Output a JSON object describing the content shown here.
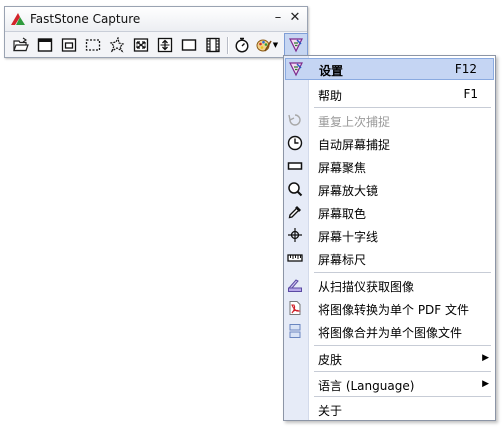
{
  "window": {
    "title": "FastStone Capture",
    "minimize_label": "–",
    "close_label": "✕"
  },
  "toolbar": {
    "tools": [
      {
        "name": "open-file-icon"
      },
      {
        "name": "capture-active-window-icon"
      },
      {
        "name": "capture-window-object-icon"
      },
      {
        "name": "capture-rectangular-region-icon"
      },
      {
        "name": "capture-freehand-region-icon"
      },
      {
        "name": "capture-full-screen-icon"
      },
      {
        "name": "capture-scrolling-window-icon"
      },
      {
        "name": "capture-fixed-region-icon"
      },
      {
        "name": "screen-recorder-icon"
      },
      {
        "name": "delay-timer-icon"
      },
      {
        "name": "output-destination-icon"
      },
      {
        "name": "settings-menu-icon"
      }
    ]
  },
  "menu": {
    "items": [
      {
        "label": "设置",
        "shortcut": "F12",
        "icon": "settings-icon",
        "state": "highlighted"
      },
      {
        "label": "帮助",
        "shortcut": "F1",
        "icon": "",
        "state": "normal"
      },
      {
        "label": "重复上次捕捉",
        "shortcut": "",
        "icon": "repeat-capture-icon",
        "state": "disabled"
      },
      {
        "label": "自动屏幕捕捉",
        "shortcut": "",
        "icon": "clock-icon",
        "state": "normal"
      },
      {
        "label": "屏幕聚焦",
        "shortcut": "",
        "icon": "focus-bar-icon",
        "state": "normal"
      },
      {
        "label": "屏幕放大镜",
        "shortcut": "",
        "icon": "magnifier-icon",
        "state": "normal"
      },
      {
        "label": "屏幕取色",
        "shortcut": "",
        "icon": "color-picker-icon",
        "state": "normal"
      },
      {
        "label": "屏幕十字线",
        "shortcut": "",
        "icon": "crosshair-icon",
        "state": "normal"
      },
      {
        "label": "屏幕标尺",
        "shortcut": "",
        "icon": "ruler-icon",
        "state": "normal"
      },
      {
        "label": "从扫描仪获取图像",
        "shortcut": "",
        "icon": "scanner-icon",
        "state": "normal"
      },
      {
        "label": "将图像转换为单个 PDF 文件",
        "shortcut": "",
        "icon": "pdf-icon",
        "state": "normal"
      },
      {
        "label": "将图像合并为单个图像文件",
        "shortcut": "",
        "icon": "combine-images-icon",
        "state": "normal"
      },
      {
        "label": "皮肤",
        "shortcut": "",
        "icon": "",
        "state": "submenu"
      },
      {
        "label": "语言 (Language)",
        "shortcut": "",
        "icon": "",
        "state": "submenu"
      },
      {
        "label": "关于",
        "shortcut": "",
        "icon": "",
        "state": "normal"
      }
    ],
    "submenu_arrow": "▶"
  },
  "colors": {
    "menu_highlight": "#c5d5f3",
    "menu_gutter": "#e6ebf7",
    "disabled_text": "#9a9a9a"
  }
}
